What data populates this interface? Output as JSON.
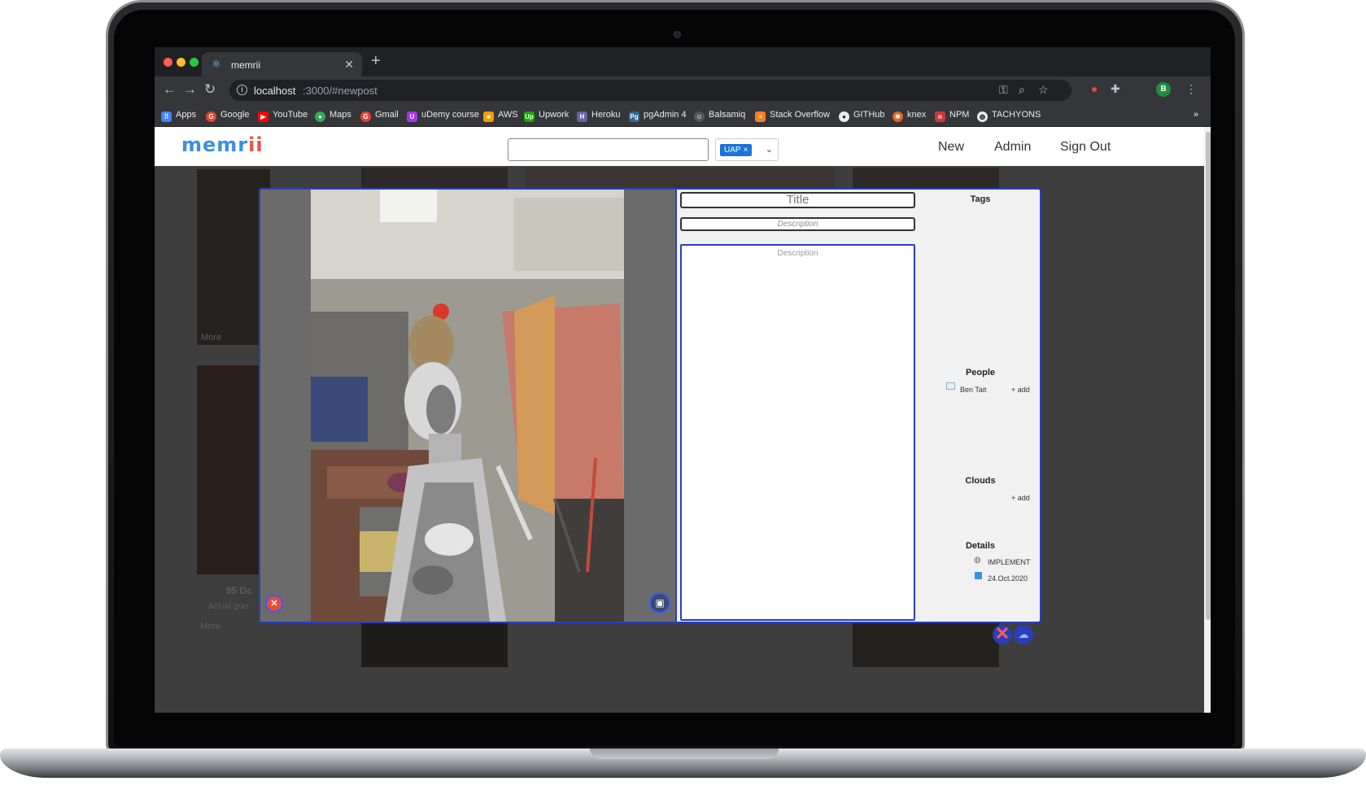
{
  "browser": {
    "tab_title": "memrii",
    "url_host": "localhost",
    "url_path": ":3000/#newpost",
    "bookmarks": [
      "Apps",
      "Google",
      "YouTube",
      "Maps",
      "Gmail",
      "uDemy course",
      "AWS",
      "Upwork",
      "Heroku",
      "pgAdmin 4",
      "Balsamiq",
      "Stack Overflow",
      "GITHub",
      "knex",
      "NPM",
      "TACHYONS"
    ],
    "bookmarks_overflow": "»",
    "profile_initial": "B"
  },
  "app": {
    "logo_main": "memr",
    "logo_accent": "ii",
    "selected_tag": "UAP",
    "nav": {
      "new": "New",
      "admin": "Admin",
      "sign_out": "Sign Out"
    }
  },
  "background": {
    "card_more_1": "More",
    "card_title": "95 Dc",
    "card_subtitle": "Actual gras",
    "card_more_2": "More"
  },
  "modal": {
    "title_placeholder": "Title",
    "description_placeholder": "Description",
    "body_placeholder": "Description",
    "tags_heading": "Tags",
    "people_heading": "People",
    "person_name": "Ben Tait",
    "people_add": "+ add",
    "clouds_heading": "Clouds",
    "clouds_add": "+ add",
    "details_heading": "Details",
    "detail_status": "IMPLEMENT",
    "detail_date": "24.Oct.2020"
  },
  "colors": {
    "accent": "#2b3fb8",
    "logo_blue": "#3a8fe0",
    "logo_red": "#e8524a",
    "tag_chip": "#1a73d9"
  }
}
